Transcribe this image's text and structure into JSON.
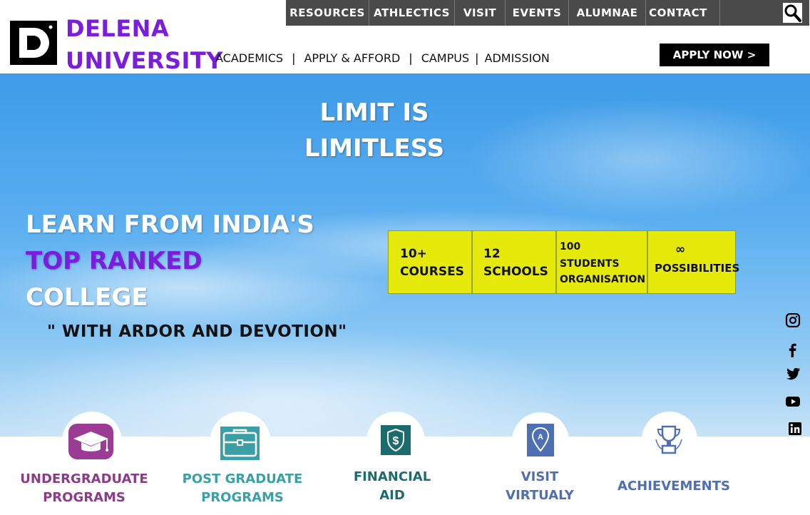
{
  "topnav": {
    "items": [
      "RESOURCES",
      "ATHLECTICS",
      "VISIT",
      "EVENTS",
      "ALUMNAE",
      "CONTACT"
    ]
  },
  "brand": {
    "line1": "DELENA",
    "line2": "UNIVERSITY",
    "logo_letter": "D"
  },
  "secnav": {
    "items": [
      "ACADEMICS",
      "APPLY & AFFORD",
      "CAMPUS",
      "ADMISSION"
    ],
    "sep": "|"
  },
  "apply_button": "APPLY NOW >",
  "hero": {
    "title_line1": "LIMIT IS",
    "title_line2": "LIMITLESS",
    "learn_line1": "LEARN FROM INDIA'S",
    "learn_line2": "TOP RANKED",
    "learn_line3": "COLLEGE",
    "tagline": "\" WITH ARDOR AND DEVOTION\""
  },
  "stats": [
    {
      "num": "10+",
      "label": "COURSES"
    },
    {
      "num": "12",
      "label": "SCHOOLS"
    },
    {
      "num": "100",
      "label": "STUDENTS ORGANISATION"
    },
    {
      "num": "∞",
      "label": "POSSIBILITIES"
    }
  ],
  "social": [
    "instagram-icon",
    "facebook-icon",
    "twitter-icon",
    "youtube-icon",
    "linkedin-icon"
  ],
  "bottom": [
    {
      "line1": "UNDERGRADUATE",
      "line2": "PROGRAMS",
      "color": "#8a3b8a",
      "icon": "graduation-cap-icon"
    },
    {
      "line1": "POST GRADUATE",
      "line2": "PROGRAMS",
      "color": "#3aa0a5",
      "icon": "briefcase-icon"
    },
    {
      "line1": "FINANCIAL",
      "line2": "AID",
      "color": "#1c6b6e",
      "icon": "dollar-shield-icon"
    },
    {
      "line1": "VISIT",
      "line2": "VIRTUALY",
      "color": "#4f6fb3",
      "icon": "map-pin-icon"
    },
    {
      "line1": "ACHIEVEMENTS",
      "line2": "",
      "color": "#4f6fb3",
      "icon": "trophy-icon"
    }
  ],
  "colors": {
    "brand": "#7a1ddc",
    "stat_bg": "#e5ea0a",
    "topbar": "#4a4a4a"
  }
}
